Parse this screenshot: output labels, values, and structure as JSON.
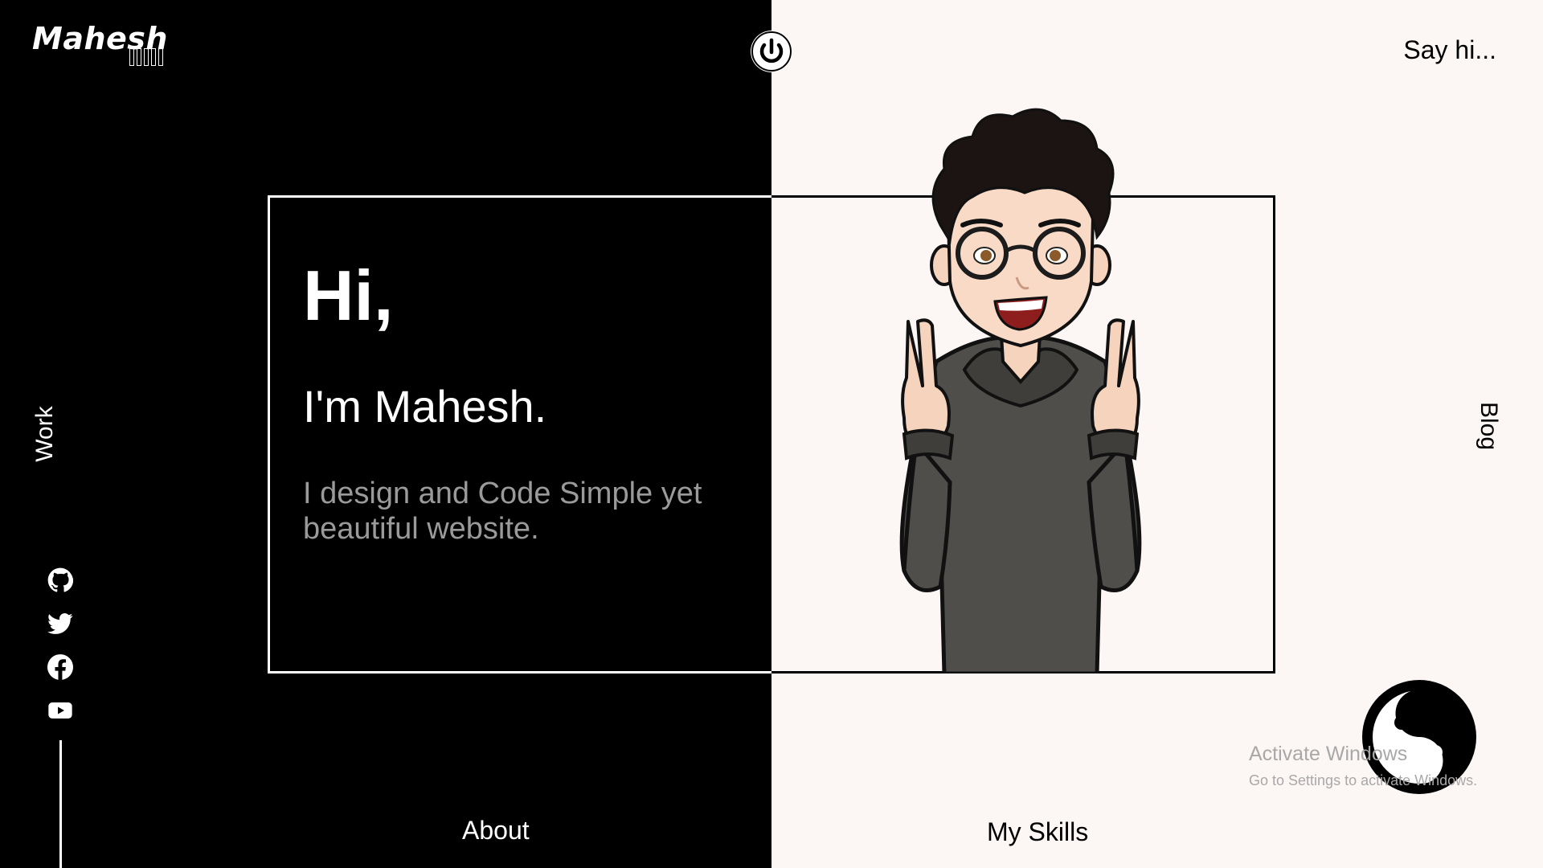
{
  "brand": {
    "logo_text": "Mahesh"
  },
  "header": {
    "say_hi_label": "Say hi..."
  },
  "nav": {
    "work_label": "Work",
    "blog_label": "Blog",
    "about_label": "About",
    "skills_label": "My Skills"
  },
  "hero": {
    "greeting": "Hi,",
    "intro": "I'm Mahesh.",
    "tagline": "I design and Code Simple yet beautiful website."
  },
  "socials": [
    {
      "icon": "github-icon"
    },
    {
      "icon": "twitter-icon"
    },
    {
      "icon": "facebook-icon"
    },
    {
      "icon": "youtube-icon"
    }
  ],
  "watermark": {
    "title": "Activate Windows",
    "subtitle": "Go to Settings to activate Windows."
  },
  "colors": {
    "dark": "#000000",
    "light": "#fcf6f4",
    "muted_text": "#9a9a9a"
  }
}
